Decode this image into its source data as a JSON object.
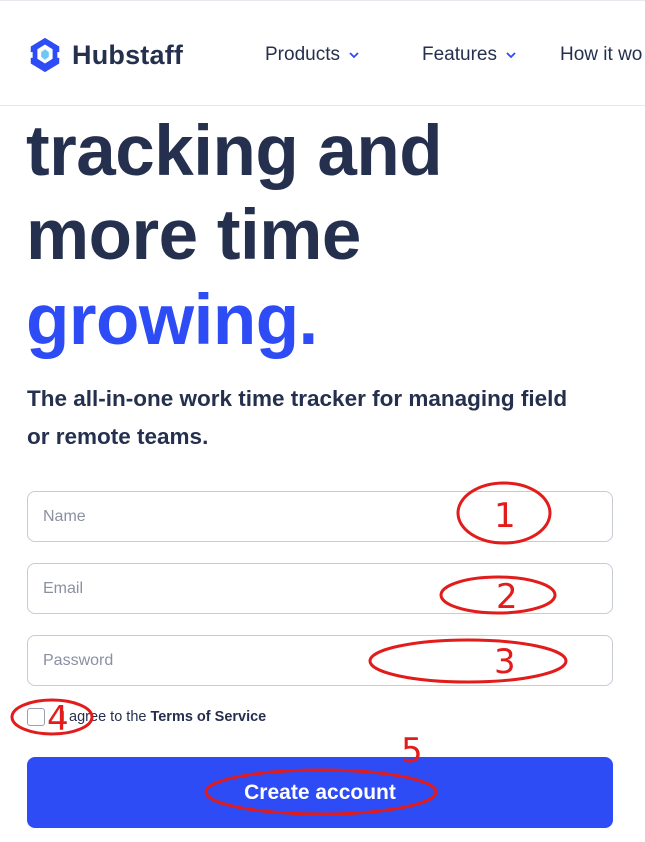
{
  "header": {
    "logo_text": "Hubstaff",
    "nav": [
      {
        "label": "Products"
      },
      {
        "label": "Features"
      },
      {
        "label": "How it wo"
      }
    ]
  },
  "hero": {
    "line1": "tracking and",
    "line2": "more time",
    "line3": "growing.",
    "subtitle_line1": "The all-in-one work time tracker for managing field",
    "subtitle_line2": "or remote teams."
  },
  "form": {
    "name_placeholder": "Name",
    "email_placeholder": "Email",
    "password_placeholder": "Password",
    "terms_prefix": "I agree to the",
    "terms_link": "Terms of Service",
    "submit_label": "Create account"
  },
  "annotations": [
    "1",
    "2",
    "3",
    "4",
    "5"
  ],
  "colors": {
    "brand_blue": "#2e4cf5",
    "text_navy": "#25304f",
    "annotation_red": "#e21b1b"
  }
}
